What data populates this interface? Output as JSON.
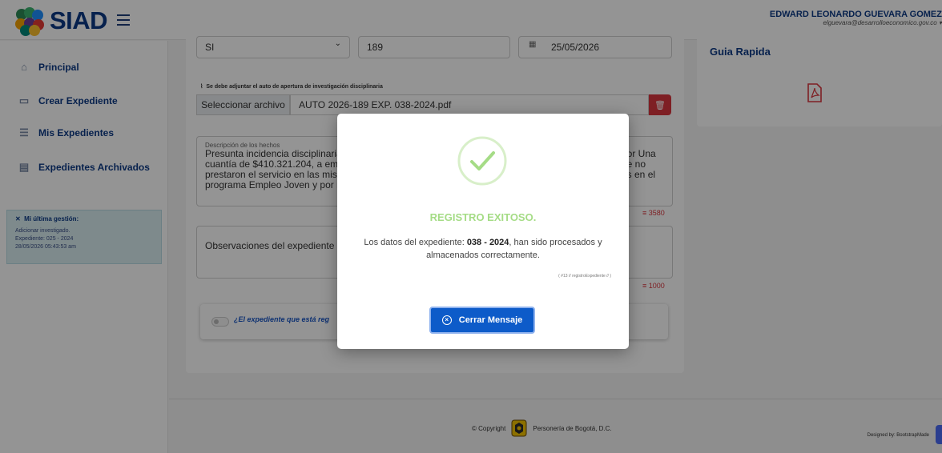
{
  "header": {
    "logo_text": "SIAD",
    "user_name": "EDWARD LEONARDO GUEVARA GOMEZ",
    "user_email": "elguevara@desarrolloeconomico.gov.co"
  },
  "sidebar": {
    "items": [
      {
        "label": "Principal",
        "icon": "home-icon"
      },
      {
        "label": "Crear Expediente",
        "icon": "folder-plus-icon"
      },
      {
        "label": "Mis Expedientes",
        "icon": "list-icon"
      },
      {
        "label": "Expedientes Archivados",
        "icon": "archive-icon"
      }
    ],
    "last": {
      "title": "Mi última gestión:",
      "lines": [
        "Adicionar investigado.",
        "Expediente: 025 - 2024",
        "28/05/2026 05:43:53 am"
      ]
    }
  },
  "form": {
    "select_value": "SI",
    "number_value": "189",
    "date_value": "25/05/2026",
    "attach_label": "Se debe adjuntar el auto de apertura de investigación disciplinaria",
    "file_button": "Seleccionar archivo",
    "file_name": "AUTO 2026-189 EXP. 038-2024.pdf",
    "description_label": "Descripción de los hechos",
    "description_left": "Presunta incidencia disciplinaria\ncuantía de $410.321.204, a emp\nprestaron el servicio en las mism\nprograma Empleo Joven y por n",
    "description_right": "por Una\nue no\nas en el",
    "description_counter": "3580",
    "observations_placeholder": "Observaciones del expediente",
    "observations_counter": "1000",
    "switch_question": "¿El expediente que está reg"
  },
  "guide": {
    "title": "Guia Rapida",
    "icon": "pdf-icon"
  },
  "footer": {
    "copyright": "© Copyright",
    "org": "Personería de Bogotá, D.C.",
    "designed_by": "Designed by: BootstrapMade"
  },
  "modal": {
    "title": "REGISTRO EXITOSO.",
    "text_prefix": "Los datos del expediente: ",
    "expediente": "038 - 2024",
    "text_suffix": ", han sido procesados y almacenados correctamente.",
    "ref": "( #13 // registroExpediente // )",
    "button": "Cerrar Mensaje",
    "success_color": "#a5dc86",
    "button_color": "#0d5bc9"
  }
}
